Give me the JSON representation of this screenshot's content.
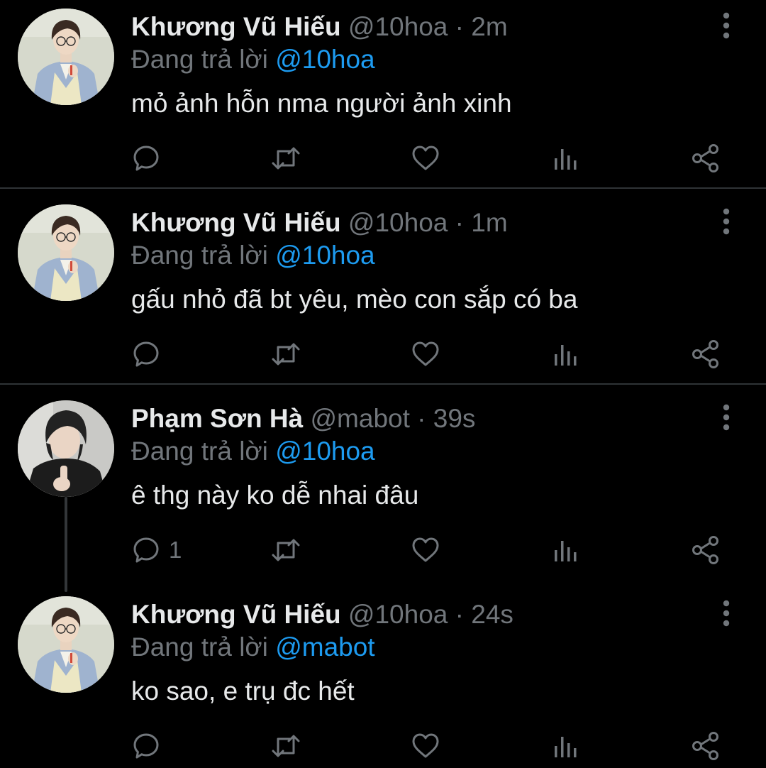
{
  "colors": {
    "background": "#000000",
    "primary_text": "#e7e9ea",
    "secondary_text": "#71767b",
    "accent": "#1d9bf0",
    "divider": "#2f3336"
  },
  "reply_prefix": "Đang trả lời",
  "icons": [
    "reply-icon",
    "retweet-icon",
    "like-icon",
    "views-icon",
    "share-icon",
    "more-options-icon"
  ],
  "tweets": [
    {
      "name": "Khương Vũ Hiếu",
      "handle": "@10hoa",
      "separator": "·",
      "time": "2m",
      "reply_to": "@10hoa",
      "text": "mỏ ảnh hỗn nma người ảnh xinh",
      "reply_count": ""
    },
    {
      "name": "Khương Vũ Hiếu",
      "handle": "@10hoa",
      "separator": "·",
      "time": "1m",
      "reply_to": "@10hoa",
      "text": "gấu nhỏ đã bt yêu, mèo con sắp có ba",
      "reply_count": ""
    },
    {
      "name": "Phạm Sơn Hà",
      "handle": "@mabot",
      "separator": "·",
      "time": "39s",
      "reply_to": "@10hoa",
      "text": "ê thg này ko dễ nhai đâu",
      "reply_count": "1"
    },
    {
      "name": "Khương Vũ Hiếu",
      "handle": "@10hoa",
      "separator": "·",
      "time": "24s",
      "reply_to": "@mabot",
      "text": "ko sao, e trụ đc hết",
      "reply_count": ""
    }
  ]
}
